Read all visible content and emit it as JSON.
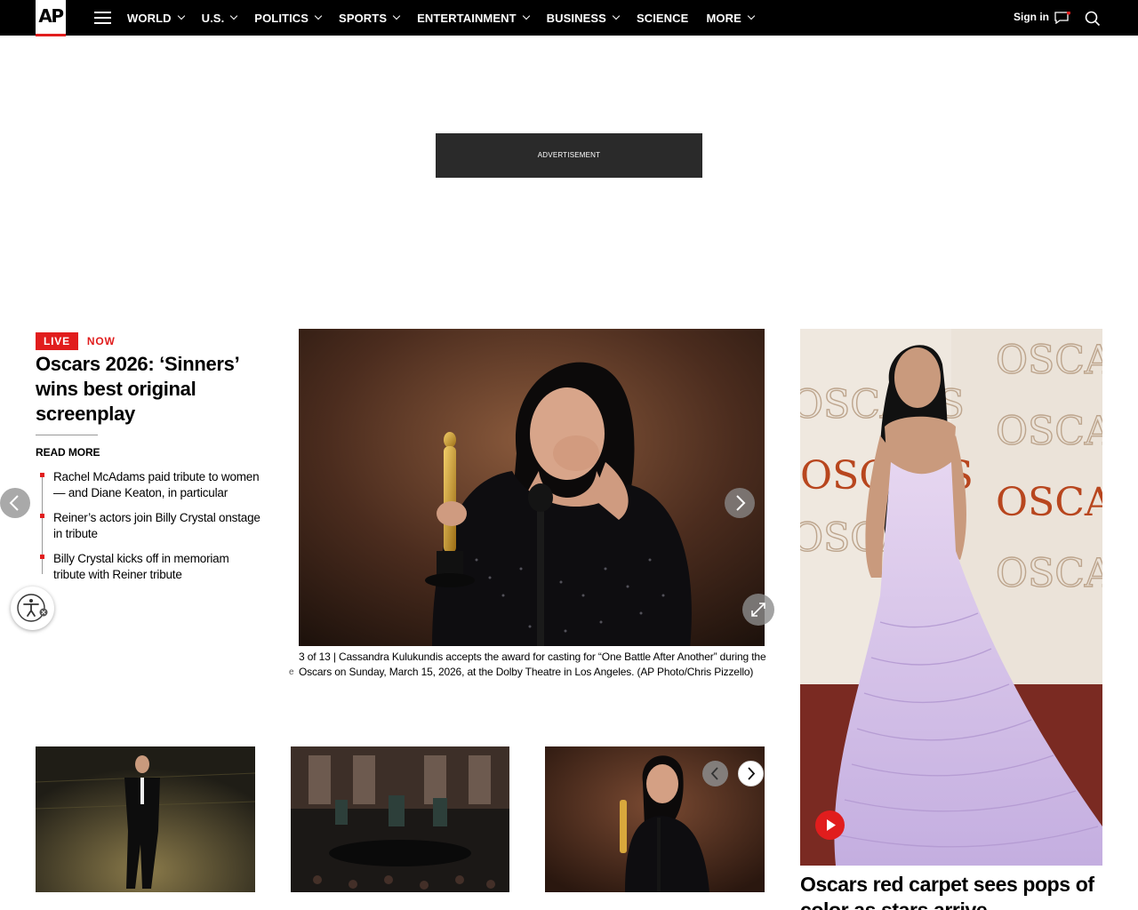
{
  "nav": {
    "logo": "AP",
    "items": [
      {
        "label": "WORLD",
        "dropdown": true
      },
      {
        "label": "U.S.",
        "dropdown": true
      },
      {
        "label": "POLITICS",
        "dropdown": true
      },
      {
        "label": "SPORTS",
        "dropdown": true
      },
      {
        "label": "ENTERTAINMENT",
        "dropdown": true
      },
      {
        "label": "BUSINESS",
        "dropdown": true
      },
      {
        "label": "SCIENCE",
        "dropdown": false
      },
      {
        "label": "MORE",
        "dropdown": true
      }
    ],
    "signin": "Sign in"
  },
  "ad": {
    "label": "ADVERTISEMENT"
  },
  "live": {
    "tag": "LIVE",
    "now": "NOW",
    "headline": "Oscars 2026: ‘Sinners’ wins best original screenplay",
    "read_more": "READ MORE",
    "related": [
      "Rachel McAdams paid tribute to women — and Diane Keaton, in particular",
      "Reiner’s actors join Billy Crystal onstage in tribute",
      "Billy Crystal kicks off in memoriam tribute with Reiner tribute"
    ]
  },
  "carousel": {
    "counter": "3 of 13",
    "separator": "|",
    "caption": "Cassandra Kulukundis accepts the award for casting for “One Battle After Another” during the Oscars on Sunday, March 15, 2026, at the Dolby Theatre in Los Angeles. (AP Photo/Chris Pizzello)",
    "edge_letter": "e"
  },
  "feature": {
    "title": "Oscars red carpet sees pops of color as stars arrive",
    "backdrop_text": "OSCARS"
  },
  "colors": {
    "accent": "#e11d1d",
    "nav_bg": "#000000",
    "ad_bg": "#2a2a2a"
  },
  "icons": [
    "menu-icon",
    "chevron-down-icon",
    "message-icon",
    "search-icon",
    "accessibility-icon",
    "chevron-left-icon",
    "chevron-right-icon",
    "expand-icon",
    "play-icon"
  ]
}
